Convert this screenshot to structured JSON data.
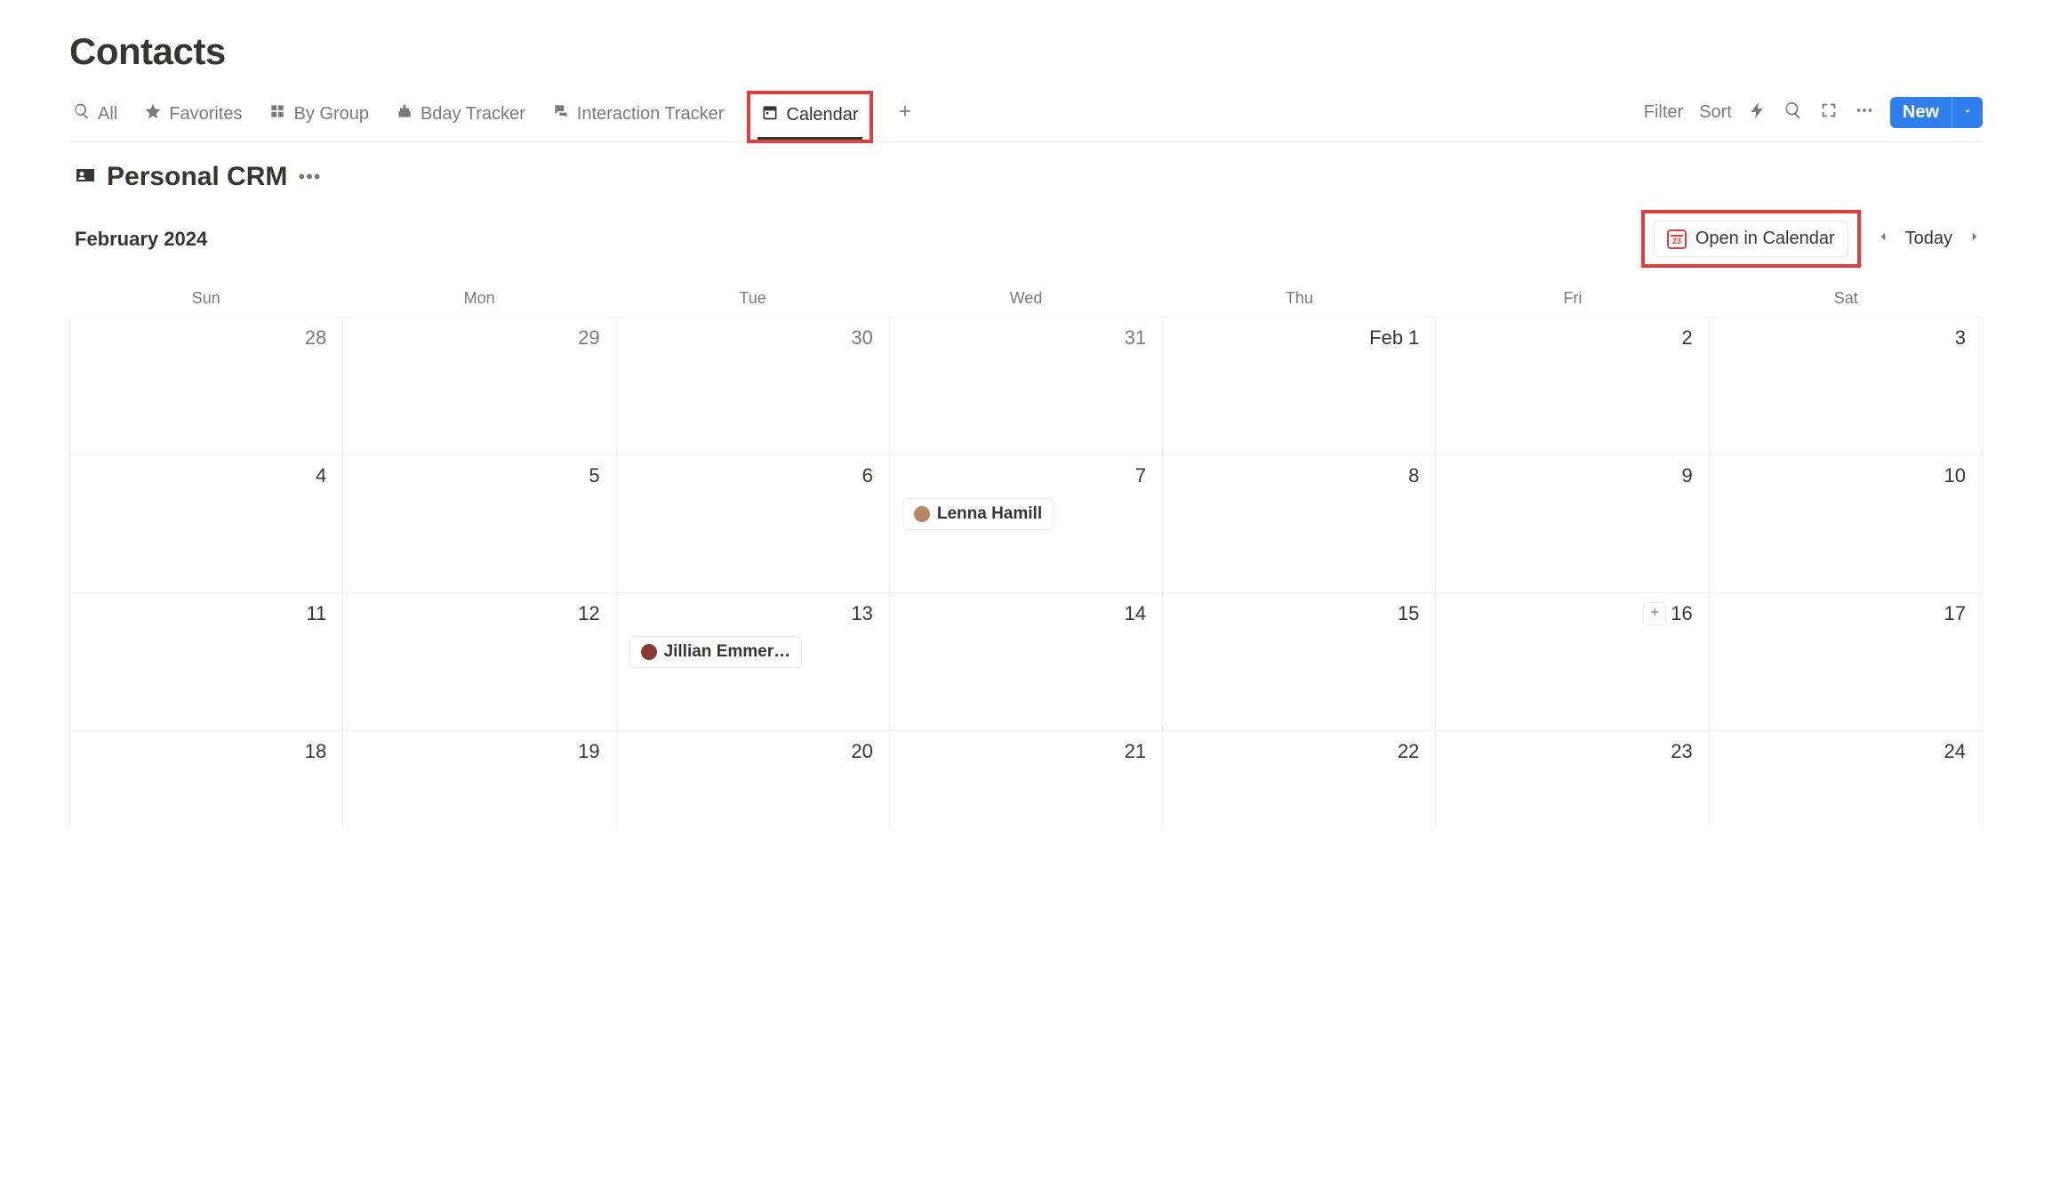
{
  "page_title": "Contacts",
  "views": [
    {
      "icon": "search",
      "label": "All"
    },
    {
      "icon": "star",
      "label": "Favorites"
    },
    {
      "icon": "group",
      "label": "By Group"
    },
    {
      "icon": "cake",
      "label": "Bday Tracker"
    },
    {
      "icon": "chat",
      "label": "Interaction Tracker"
    },
    {
      "icon": "calendar",
      "label": "Calendar",
      "active": true
    }
  ],
  "toolbar": {
    "filter": "Filter",
    "sort": "Sort",
    "new": "New"
  },
  "database": {
    "title": "Personal CRM"
  },
  "calendar": {
    "month_label": "February 2024",
    "open_label": "Open in Calendar",
    "open_icon_num": "23",
    "today": "Today",
    "weekdays": [
      "Sun",
      "Mon",
      "Tue",
      "Wed",
      "Thu",
      "Fri",
      "Sat"
    ],
    "weeks": [
      [
        {
          "num": "28",
          "other": true
        },
        {
          "num": "29",
          "other": true
        },
        {
          "num": "30",
          "other": true
        },
        {
          "num": "31",
          "other": true
        },
        {
          "num": "Feb 1"
        },
        {
          "num": "2"
        },
        {
          "num": "3"
        }
      ],
      [
        {
          "num": "4"
        },
        {
          "num": "5"
        },
        {
          "num": "6"
        },
        {
          "num": "7",
          "event": {
            "name": "Lenna Hamill",
            "avatar": "#b8865f"
          }
        },
        {
          "num": "8"
        },
        {
          "num": "9"
        },
        {
          "num": "10"
        }
      ],
      [
        {
          "num": "11"
        },
        {
          "num": "12"
        },
        {
          "num": "13",
          "event": {
            "name": "Jillian Emmer…",
            "avatar": "#8b3a2f"
          }
        },
        {
          "num": "14"
        },
        {
          "num": "15"
        },
        {
          "num": "16",
          "show_add": true
        },
        {
          "num": "17"
        }
      ],
      [
        {
          "num": "18"
        },
        {
          "num": "19"
        },
        {
          "num": "20"
        },
        {
          "num": "21"
        },
        {
          "num": "22"
        },
        {
          "num": "23"
        },
        {
          "num": "24"
        }
      ]
    ]
  }
}
